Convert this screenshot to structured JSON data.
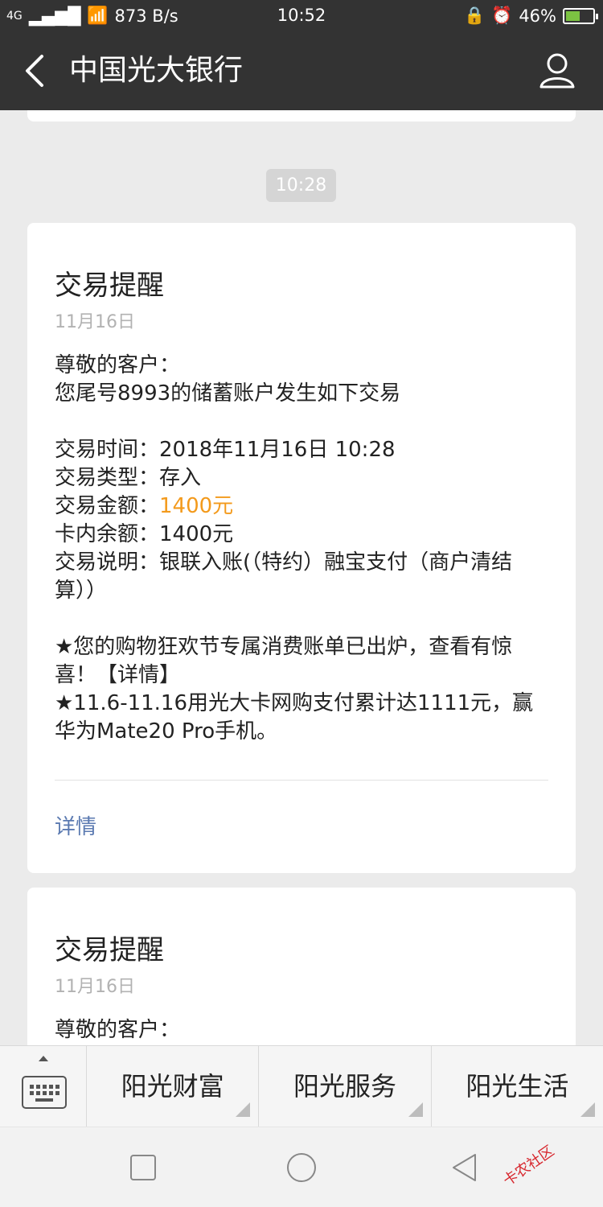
{
  "status_bar": {
    "signal": "4G",
    "speed": "873 B/s",
    "time": "10:52",
    "battery": "46%"
  },
  "header": {
    "title": "中国光大银行"
  },
  "chat": {
    "time_chip": "10:28",
    "cards": [
      {
        "title": "交易提醒",
        "date": "11月16日",
        "lines": [
          "尊敬的客户：",
          "您尾号8993的储蓄账户发生如下交易",
          "",
          "交易时间：2018年11月16日  10:28",
          "交易类型：存入",
          "交易金额：1400元",
          "卡内余额：1400元",
          "交易说明：银联入账(（特约）融宝支付（商户清结算））",
          "",
          "★您的购物狂欢节专属消费账单已出炉，查看有惊喜！【详情】",
          "★11.6-11.16用光大卡网购支付累计达1111元，赢华为Mate20 Pro手机。"
        ],
        "highlight_line": "交易金额：1400元",
        "highlight_value": "1400元",
        "detail_link": "详情"
      },
      {
        "title": "交易提醒",
        "date": "11月16日",
        "lines": [
          "尊敬的客户："
        ]
      }
    ]
  },
  "menu": {
    "items": [
      {
        "label": "阳光财富"
      },
      {
        "label": "阳光服务"
      },
      {
        "label": "阳光生活"
      }
    ]
  },
  "watermark": {
    "text": "卡农社区"
  },
  "colors": {
    "header_bg": "#333333",
    "highlight": "#f39a1c",
    "link": "#5b7ab1"
  }
}
